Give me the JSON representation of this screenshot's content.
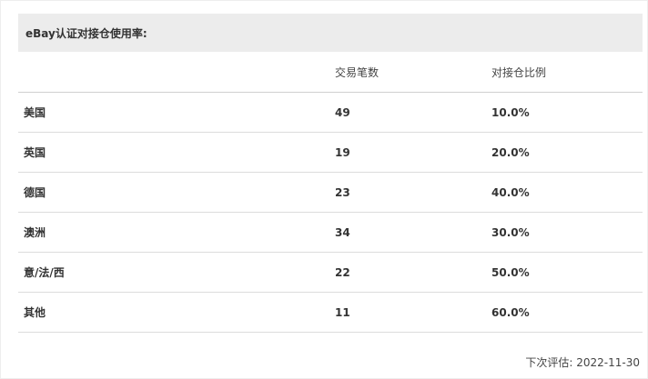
{
  "panel": {
    "title": "eBay认证对接仓使用率:"
  },
  "table": {
    "columns": [
      "",
      "交易笔数",
      "对接仓比例"
    ],
    "rows": [
      {
        "region": "美国",
        "transactions": "49",
        "ratio": "10.0%"
      },
      {
        "region": "英国",
        "transactions": "19",
        "ratio": "20.0%"
      },
      {
        "region": "德国",
        "transactions": "23",
        "ratio": "40.0%"
      },
      {
        "region": "澳洲",
        "transactions": "34",
        "ratio": "30.0%"
      },
      {
        "region": "意/法/西",
        "transactions": "22",
        "ratio": "50.0%"
      },
      {
        "region": "其他",
        "transactions": "11",
        "ratio": "60.0%"
      }
    ]
  },
  "footer": {
    "next_evaluation": "下次评估: 2022-11-30"
  }
}
